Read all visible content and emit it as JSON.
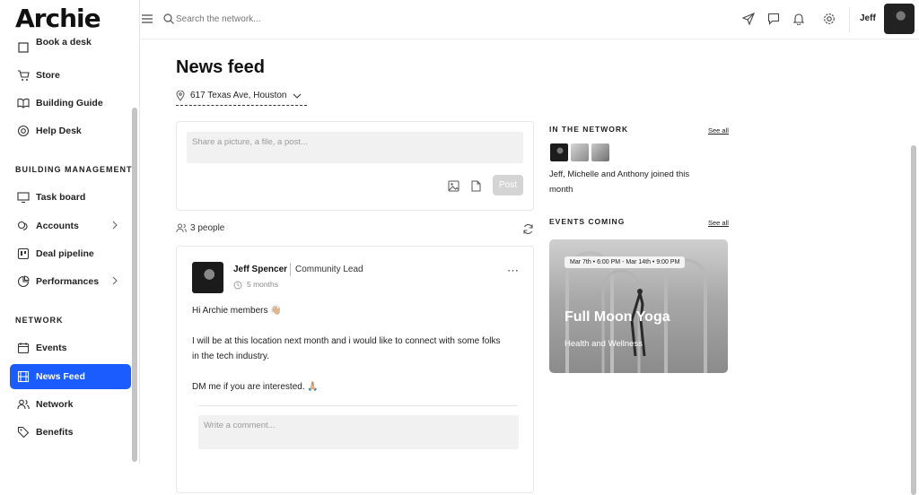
{
  "app": {
    "logo": "Archie"
  },
  "sidebar": {
    "items": [
      {
        "label": "Book a desk"
      },
      {
        "label": "Store"
      },
      {
        "label": "Building Guide"
      },
      {
        "label": "Help Desk"
      },
      {
        "label": "Task board"
      },
      {
        "label": "Accounts"
      },
      {
        "label": "Deal pipeline"
      },
      {
        "label": "Performances"
      },
      {
        "label": "Events"
      },
      {
        "label": "News Feed"
      },
      {
        "label": "Network"
      },
      {
        "label": "Benefits"
      }
    ],
    "sections": {
      "building_management": "BUILDING MANAGEMENT",
      "network": "NETWORK"
    }
  },
  "header": {
    "search_placeholder": "Search the network...",
    "user_name": "Jeff"
  },
  "page": {
    "title": "News feed",
    "location": "617 Texas Ave, Houston"
  },
  "composer": {
    "placeholder": "Share a picture, a file, a post...",
    "post_label": "Post"
  },
  "feed": {
    "people_count": "3 people",
    "post": {
      "author": "Jeff Spencer",
      "role": "Community Lead",
      "time": "5 months",
      "line1": "Hi Archie members 👋🏼",
      "line2": "I will be at this location next month and i would like to connect with some folks",
      "line3": "in the tech industry.",
      "line4": "DM me if you are interested. 🙏🏼",
      "comment_placeholder": "Write a comment..."
    }
  },
  "network": {
    "title": "IN THE NETWORK",
    "see_all": "See all",
    "joined_text_1": "Jeff, Michelle and Anthony joined this",
    "joined_text_2": "month"
  },
  "events": {
    "title": "EVENTS COMING",
    "see_all": "See all",
    "event": {
      "dates": "Mar 7th • 6:00 PM - Mar 14th • 9:00 PM",
      "name": "Full Moon Yoga",
      "category": "Health and Wellness"
    }
  },
  "colors": {
    "accent": "#1a5cff"
  }
}
